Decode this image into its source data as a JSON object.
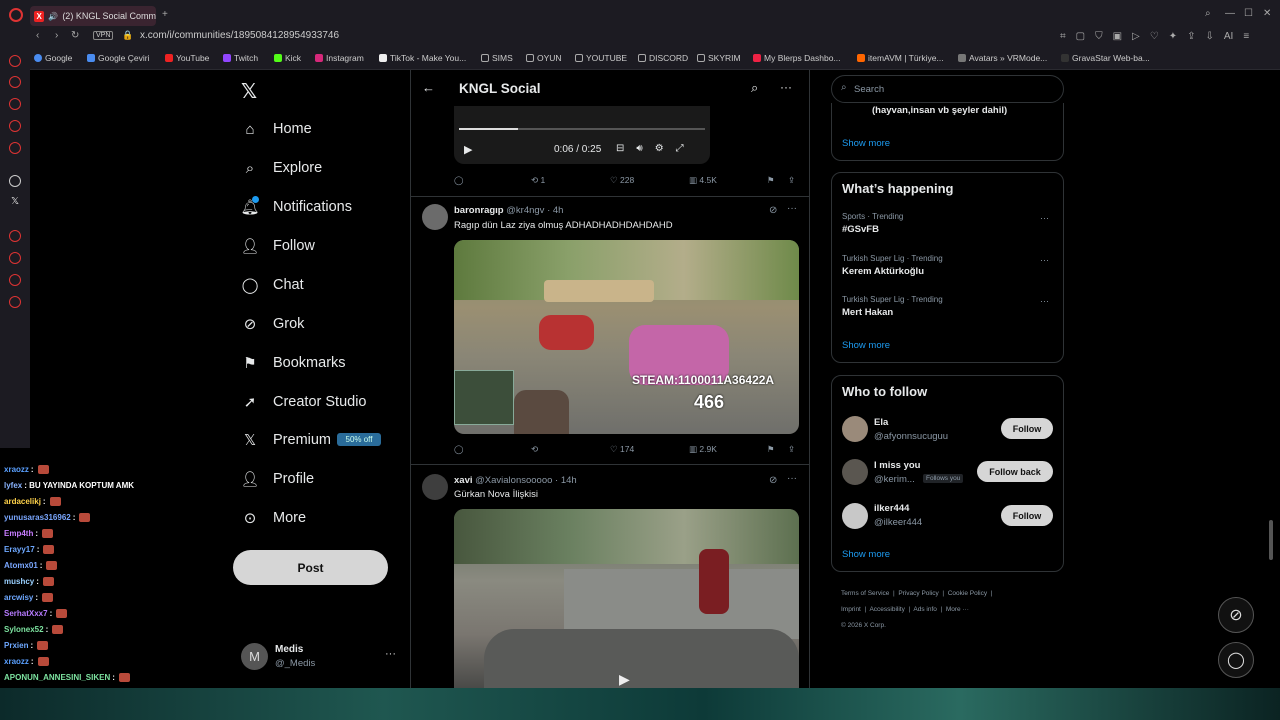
{
  "browser": {
    "tab_title": "(2) KNGL Social Comm",
    "url": "x.com/i/communities/1895084128954933746",
    "vpn": "VPN",
    "bookmarks": [
      "Google",
      "Google Çeviri",
      "YouTube",
      "Twitch",
      "Kick",
      "Instagram",
      "TikTok - Make You...",
      "SIMS",
      "OYUN",
      "YOUTUBE",
      "DISCORD",
      "SKYRIM",
      "My Blerps Dashbo...",
      "itemAVM | Türkiye...",
      "Avatars » VRMode...",
      "GravaStar Web-ba..."
    ],
    "ai_label": "AI"
  },
  "nav": {
    "items": [
      "Home",
      "Explore",
      "Notifications",
      "Follow",
      "Chat",
      "Grok",
      "Bookmarks",
      "Creator Studio",
      "Premium",
      "Profile",
      "More"
    ],
    "premium_badge": "50% off",
    "post": "Post",
    "user_name": "Medis",
    "user_handle": "@_Medis",
    "avatar_initial": "M"
  },
  "header": {
    "title": "KNGL Social"
  },
  "tweets": [
    {
      "video_time": "0:06 / 0:25",
      "replies": "",
      "retweets": "1",
      "likes": "228",
      "views": "4.5K"
    },
    {
      "name": "baronragıp",
      "handle": "@kr4ngv · 4h",
      "text": "Ragıp dün Laz ziya olmuş ADHADHADHDAHDAHD",
      "media_text_1": "STEAM:1100011A36422A",
      "media_text_2": "466",
      "replies": "",
      "retweets": "",
      "likes": "174",
      "views": "2.9K"
    },
    {
      "name": "xavi",
      "handle": "@Xavialonsooooo · 14h",
      "text": "Gürkan Nova İlişkisi"
    }
  ],
  "right": {
    "search_placeholder": "Search",
    "top_text": "(hayvan,insan vb şeyler dahil)",
    "show_more": "Show more",
    "happening_title": "What’s happening",
    "trends": [
      {
        "meta": "Sports · Trending",
        "name": "#GSvFB"
      },
      {
        "meta": "Turkish Super Lig · Trending",
        "name": "Kerem Aktürkoğlu"
      },
      {
        "meta": "Turkish Super Lig · Trending",
        "name": "Mert Hakan"
      }
    ],
    "who_title": "Who to follow",
    "follow": [
      {
        "name": "Ela",
        "handle": "@afyonnsucuguu",
        "button": "Follow"
      },
      {
        "name": "I miss you",
        "handle": "@kerim...",
        "badge": "Follows you",
        "button": "Follow back"
      },
      {
        "name": "ilker444",
        "handle": "@ilkeer444",
        "button": "Follow"
      }
    ],
    "footer": [
      "Terms of Service",
      "Privacy Policy",
      "Cookie Policy",
      "Imprint",
      "Accessibility",
      "Ads info",
      "More ···",
      "© 2026 X Corp."
    ]
  },
  "chat": [
    {
      "user": "xraozz",
      "msg": ":",
      "color": "#5aa0ff"
    },
    {
      "user": "lyfex",
      "msg": ": BU YAYINDA KOPTUM AMK",
      "color": "#8ab4ff"
    },
    {
      "user": "ardacelikj",
      "msg": ":",
      "color": "#ffd24a"
    },
    {
      "user": "yunusaras316962",
      "msg": ":",
      "color": "#7aa7ff"
    },
    {
      "user": "Emp4th",
      "msg": ":",
      "color": "#c77dff"
    },
    {
      "user": "Erayy17",
      "msg": ":",
      "color": "#6ea8ff"
    },
    {
      "user": "Atomx01",
      "msg": ":",
      "color": "#7aa7ff"
    },
    {
      "user": "mushcy",
      "msg": ":",
      "color": "#9ad0ff"
    },
    {
      "user": "arcwisy",
      "msg": ":",
      "color": "#6ea8ff"
    },
    {
      "user": "SerhatXxx7",
      "msg": ":",
      "color": "#b67aff"
    },
    {
      "user": "Sylonex52",
      "msg": ":",
      "color": "#7de3a0"
    },
    {
      "user": "Prxien",
      "msg": ":",
      "color": "#6ea8ff"
    },
    {
      "user": "xraozz",
      "msg": ":",
      "color": "#5aa0ff"
    },
    {
      "user": "APONUN_ANNESINI_SIKEN",
      "msg": ":",
      "color": "#7de3a0"
    }
  ]
}
